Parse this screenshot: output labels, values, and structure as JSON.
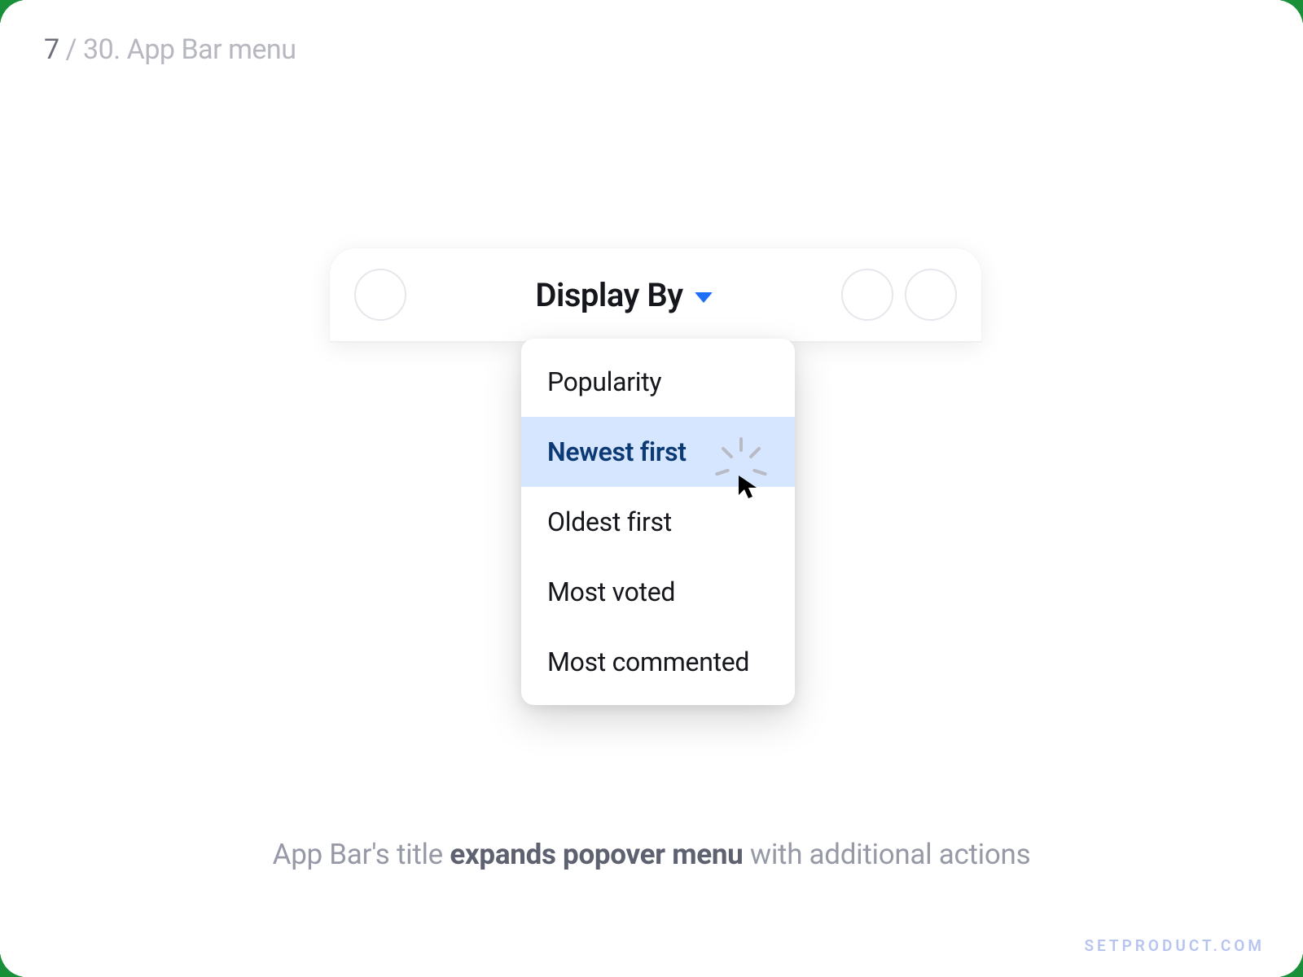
{
  "breadcrumb": {
    "current": "7",
    "total": "30",
    "title": "App Bar menu"
  },
  "appbar": {
    "title": "Display By"
  },
  "menu": {
    "items": [
      {
        "label": "Popularity"
      },
      {
        "label": "Newest first"
      },
      {
        "label": "Oldest first"
      },
      {
        "label": "Most voted"
      },
      {
        "label": "Most commented"
      }
    ],
    "selected_index": 1
  },
  "caption": {
    "pre": "App Bar's title ",
    "bold": "expands popover menu",
    "post": " with additional actions"
  },
  "watermark": "SETPRODUCT.COM"
}
